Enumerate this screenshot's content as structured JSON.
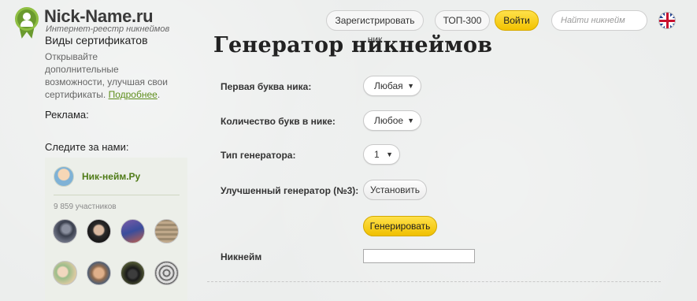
{
  "header": {
    "logo_title": "Nick-Name.ru",
    "logo_subtitle": "Интернет-реестр никнеймов",
    "register_label": "Зарегистрировать ник",
    "top300_label": "ТОП-300",
    "login_label": "Войти",
    "search_placeholder": "Найти никнейм",
    "language_icon": "uk-flag-icon"
  },
  "sidebar": {
    "cert_title": "Виды сертификатов",
    "cert_text": "Открывайте дополнительные возможности, улучшая свои сертификаты.",
    "cert_link": "Подробнее",
    "cert_link_suffix": ".",
    "ads_label": "Реклама:",
    "follow_label": "Следите за нами:",
    "vk_widget": {
      "group_name": "Ник-нейм.Ру",
      "members_text": "9 859 участников",
      "member_count": 8
    }
  },
  "main": {
    "title": "Генератор никнеймов",
    "fields": {
      "first_letter_label": "Первая буква ника:",
      "first_letter_value": "Любая",
      "letter_count_label": "Количество букв в нике:",
      "letter_count_value": "Любое",
      "generator_type_label": "Тип генератора:",
      "generator_type_value": "1",
      "improved_label": "Улучшенный генератор (№3):",
      "install_label": "Установить",
      "generate_label": "Генерировать",
      "nickname_label": "Никнейм",
      "nickname_value": ""
    }
  },
  "colors": {
    "accent_yellow": "#f2c200",
    "link_green": "#5e8e1c",
    "logo_green": "#6a9a2e"
  }
}
